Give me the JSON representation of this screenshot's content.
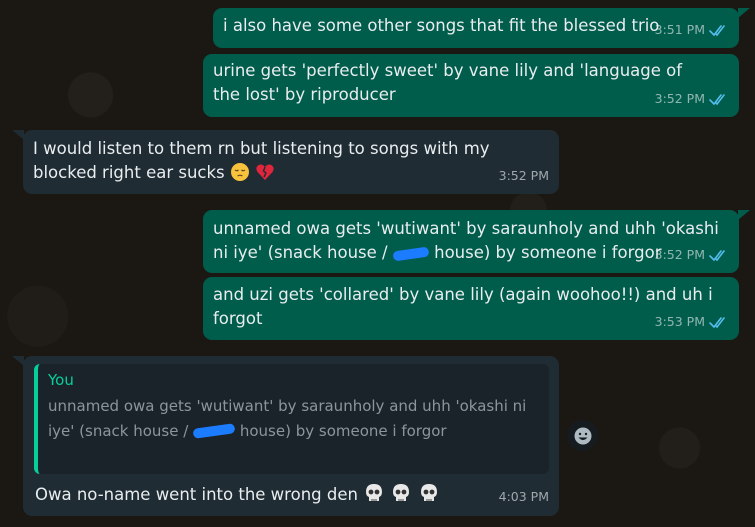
{
  "messages": [
    {
      "dir": "out",
      "text": "i also have some other songs that fit the blessed trio",
      "time": "3:51 PM"
    },
    {
      "dir": "out",
      "text": "urine gets 'perfectly sweet' by vane lily and 'language of the lost' by riproducer",
      "time": "3:52 PM"
    },
    {
      "dir": "in",
      "text": "I would listen to them rn but listening to songs with my blocked right ear sucks",
      "emoji": [
        "pensive-face",
        "broken-heart"
      ],
      "time": "3:52 PM"
    },
    {
      "dir": "out",
      "text_a": "unnamed owa gets 'wutiwant' by saraunholy and uhh 'okashi ni iye' (snack house /",
      "text_b": "house) by someone i forgor",
      "time": "3:52 PM"
    },
    {
      "dir": "out",
      "text": "and uzi gets 'collared' by vane lily (again woohoo!!) and uh i forgot",
      "time": "3:53 PM"
    },
    {
      "dir": "in",
      "reply": {
        "author": "You",
        "text_a": "unnamed owa gets 'wutiwant' by saraunholy and uhh 'okashi ni iye' (snack house /",
        "text_b": "house) by someone i forgor"
      },
      "text": "Owa no-name went into the wrong den",
      "emoji": [
        "skull",
        "skull",
        "skull"
      ],
      "time": "4:03 PM"
    }
  ],
  "colors": {
    "outgoing": "#005c4b",
    "incoming": "#1f2c33",
    "read_ticks": "#53bdeb",
    "reply_accent": "#06cf9c"
  },
  "icons": {
    "read_receipt": "double-check-icon",
    "react": "emoji-react-icon"
  }
}
